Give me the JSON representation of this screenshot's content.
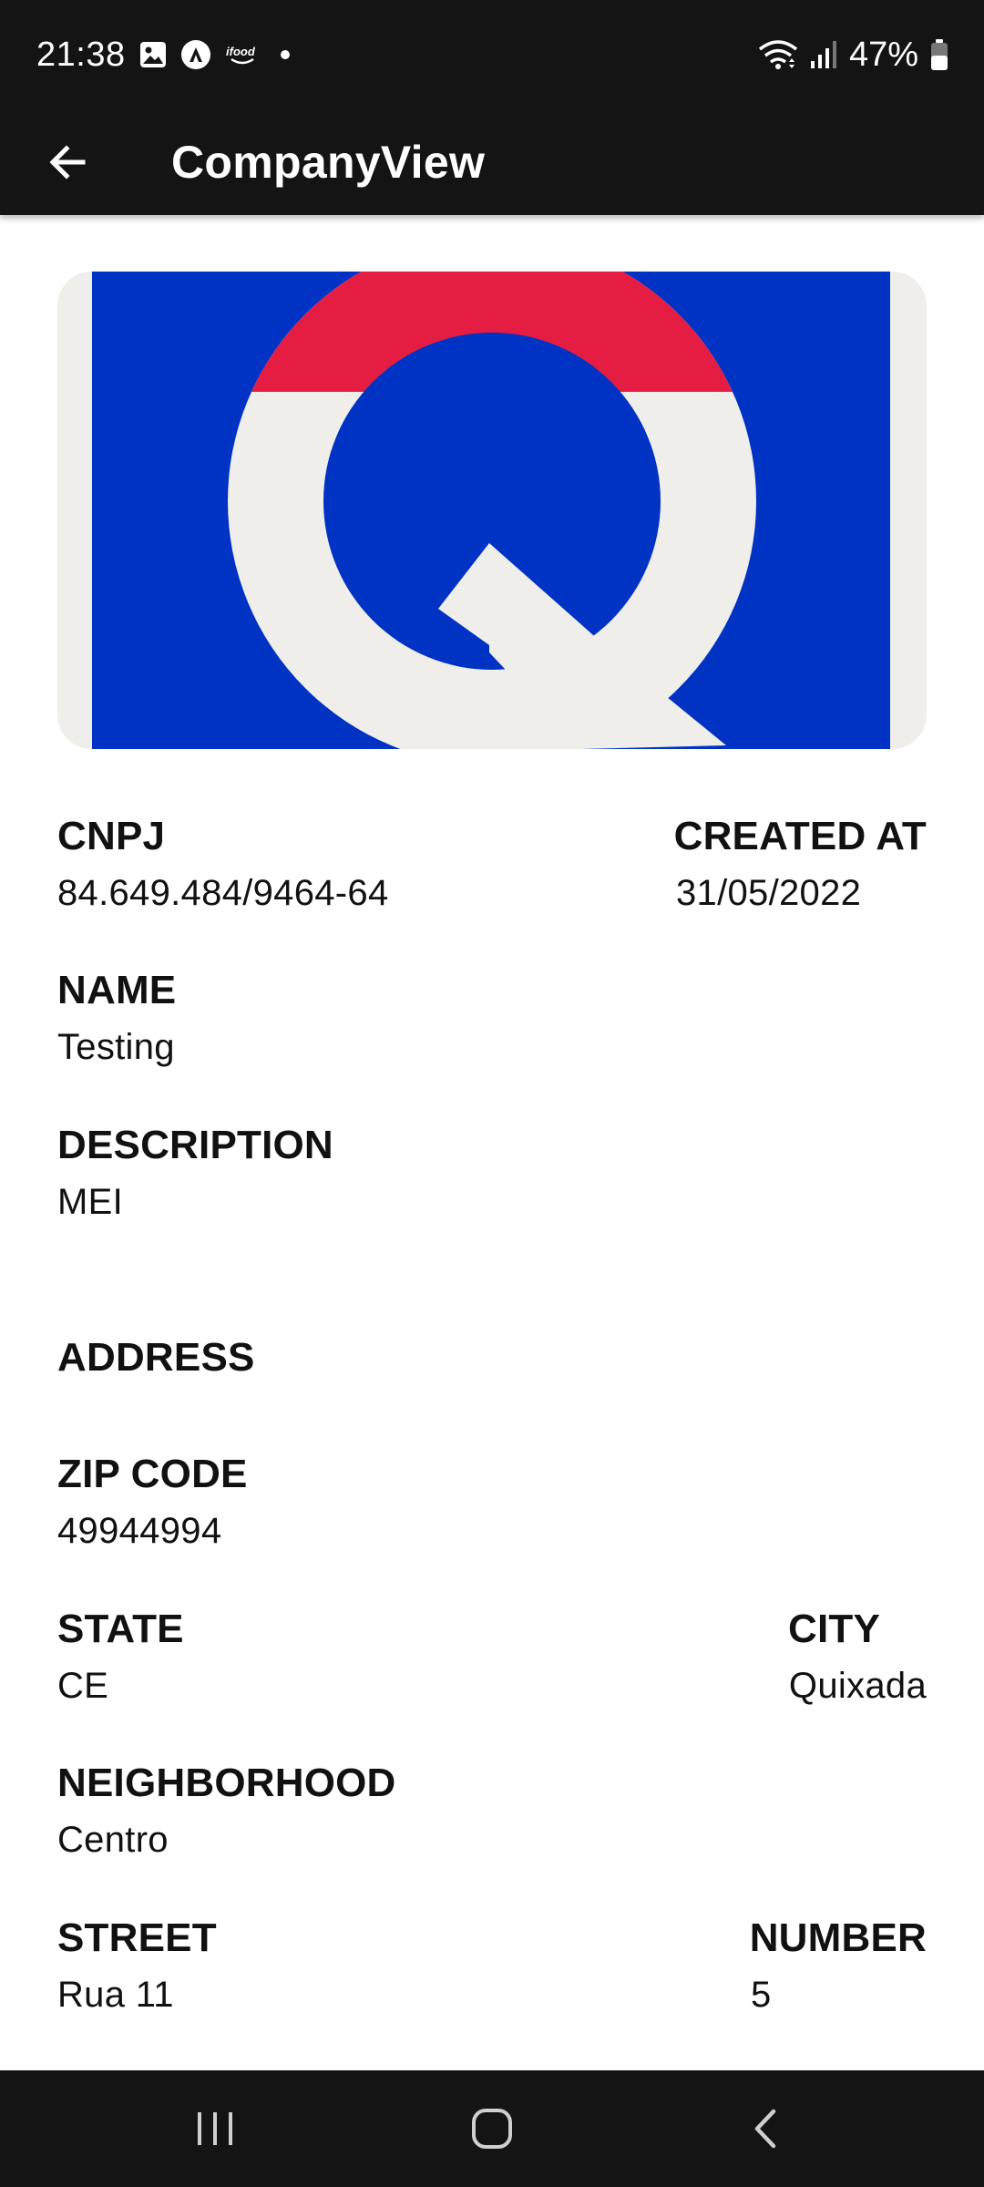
{
  "status_bar": {
    "time": "21:38",
    "icons_left": [
      "image-icon",
      "app-a-icon",
      "ifood-icon",
      "dot-icon"
    ],
    "icons_right": [
      "wifi-icon",
      "signal-icon",
      "battery-icon"
    ],
    "battery": "47%"
  },
  "app_bar": {
    "title": "CompanyView",
    "back_icon": "arrow-left-icon"
  },
  "logo": {
    "letter_shape": "Q",
    "colors": {
      "blue": "#0033c4",
      "red": "#e61d42",
      "white": "#efeeea"
    }
  },
  "company": {
    "cnpj_label": "CNPJ",
    "cnpj": "84.649.484/9464-64",
    "created_label": "CREATED AT",
    "created": "31/05/2022",
    "name_label": "NAME",
    "name": "Testing",
    "description_label": "DESCRIPTION",
    "description": "MEI"
  },
  "address": {
    "section_label": "ADDRESS",
    "zip_label": "ZIP CODE",
    "zip": "49944994",
    "state_label": "STATE",
    "state": "CE",
    "city_label": "CITY",
    "city": "Quixada",
    "neighborhood_label": "NEIGHBORHOOD",
    "neighborhood": "Centro",
    "street_label": "STREET",
    "street": "Rua 11",
    "number_label": "NUMBER",
    "number": "5"
  },
  "nav_bar": {
    "recents_icon": "recents-icon",
    "home_icon": "home-icon",
    "back_icon": "back-chevron-icon"
  }
}
